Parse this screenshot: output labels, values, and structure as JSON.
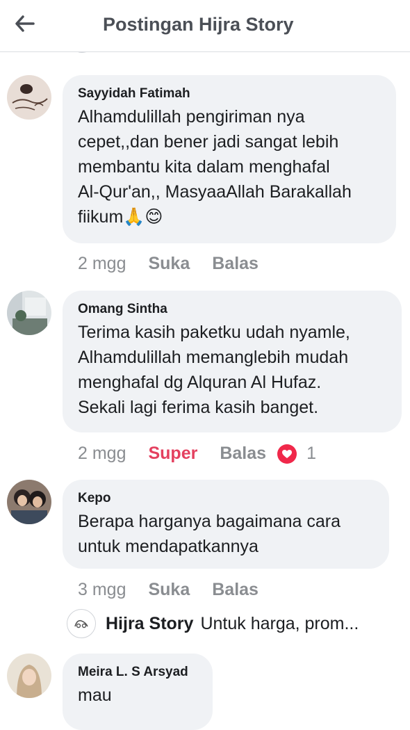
{
  "header": {
    "title": "Postingan Hijra Story",
    "back_icon": "arrow-left-icon"
  },
  "comments": [
    {
      "author": "Sayyidah Fatimah",
      "lines": [
        "Alhamdulillah pengiriman nya",
        "cepet,,dan bener jadi sangat lebih",
        "membantu kita dalam menghafal",
        "Al-Qur'an,, MasyaaAllah Barakallah",
        "fiikum🙏😊"
      ],
      "time": "2 mgg",
      "like_label": "Suka",
      "reply_label": "Balas"
    },
    {
      "author": "Omang Sintha",
      "lines": [
        "Terima kasih paketku udah nyamle,",
        "Alhamdulillah memanglebih mudah",
        "menghafal dg Alquran Al Hufaz.",
        "Sekali lagi ferima kasih banget."
      ],
      "time": "2 mgg",
      "like_label": "Super",
      "reply_label": "Balas",
      "reaction_icon": "love-reaction-icon",
      "reaction_count": "1",
      "reaction_color": "#f0284a"
    },
    {
      "author": "Kepo",
      "lines": [
        "Berapa harganya bagaimana cara",
        "untuk mendapatkannya"
      ],
      "time": "3 mgg",
      "like_label": "Suka",
      "reply_label": "Balas",
      "reply_preview": {
        "author": "Hijra Story",
        "text": "Untuk harga, prom..."
      }
    },
    {
      "author": "Meira L. S Arsyad",
      "lines": [
        "mau"
      ]
    }
  ],
  "colors": {
    "bubble": "#f0f2f5",
    "super": "#e4405f",
    "muted": "#8a8d91"
  }
}
